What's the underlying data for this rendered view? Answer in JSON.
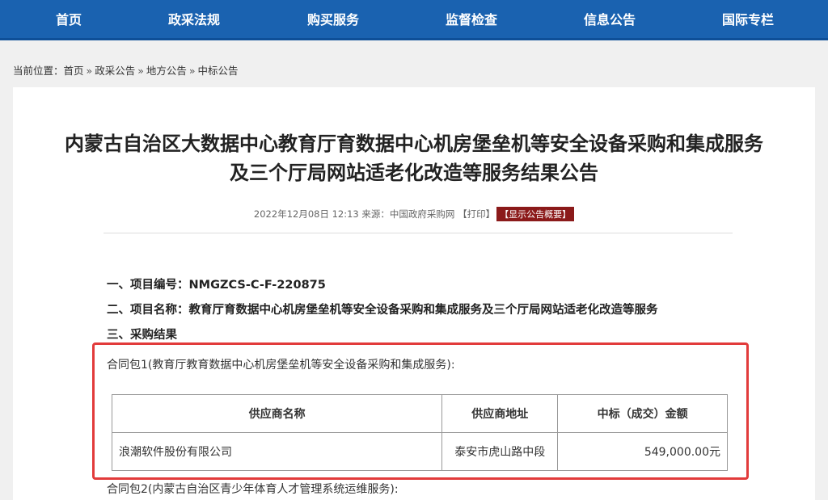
{
  "nav": {
    "items": [
      {
        "label": "首页"
      },
      {
        "label": "政采法规"
      },
      {
        "label": "购买服务"
      },
      {
        "label": "监督检查"
      },
      {
        "label": "信息公告"
      },
      {
        "label": "国际专栏"
      }
    ]
  },
  "breadcrumb": {
    "prefix": "当前位置：",
    "items": [
      "首页",
      "政采公告",
      "地方公告",
      "中标公告"
    ],
    "separator": "»"
  },
  "article": {
    "title_line1": "内蒙古自治区大数据中心教育厅育数据中心机房堡垒机等安全设备采购和集成服务",
    "title_line2": "及三个厅局网站适老化改造等服务结果公告",
    "meta": {
      "date": "2022年12月08日 12:13",
      "source_label": "来源：",
      "source": "中国政府采购网",
      "print": "【打印】",
      "summary": "【显示公告概要】"
    },
    "item1": "一、项目编号：NMGZCS-C-F-220875",
    "item2": "二、项目名称：教育厅育数据中心机房堡垒机等安全设备采购和集成服务及三个厅局网站适老化改造等服务",
    "item3": "三、采购结果",
    "package1": "合同包1(教育厅教育数据中心机房堡垒机等安全设备采购和集成服务):",
    "package2": "合同包2(内蒙古自治区青少年体育人才管理系统运维服务):",
    "table": {
      "headers": [
        "供应商名称",
        "供应商地址",
        "中标（成交）金额"
      ],
      "rows": [
        [
          "浪潮软件股份有限公司",
          "泰安市虎山路中段",
          "549,000.00元"
        ]
      ]
    }
  },
  "colors": {
    "nav_bg": "#1a62b0",
    "highlight": "#e23b3b",
    "summary_badge": "#8b1a1a"
  }
}
